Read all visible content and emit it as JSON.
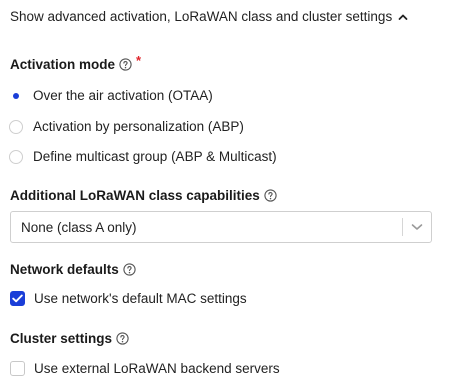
{
  "toggle": {
    "label": "Show advanced activation, LoRaWAN class and cluster settings",
    "icon": "chevron-up-icon"
  },
  "activation_mode": {
    "heading": "Activation mode",
    "required_mark": "*",
    "options": [
      {
        "label": "Over the air activation (OTAA)",
        "selected": true
      },
      {
        "label": "Activation by personalization (ABP)",
        "selected": false
      },
      {
        "label": "Define multicast group (ABP & Multicast)",
        "selected": false
      }
    ]
  },
  "class_capabilities": {
    "heading": "Additional LoRaWAN class capabilities",
    "selected_value": "None (class A only)"
  },
  "network_defaults": {
    "heading": "Network defaults",
    "checkbox_label": "Use network's default MAC settings",
    "checked": true
  },
  "cluster_settings": {
    "heading": "Cluster settings",
    "checkbox_label": "Use external LoRaWAN backend servers",
    "checked": false
  },
  "colors": {
    "accent": "#1a3ed8",
    "required": "#e0252c",
    "border": "#cfcfcf",
    "text": "#222222"
  }
}
